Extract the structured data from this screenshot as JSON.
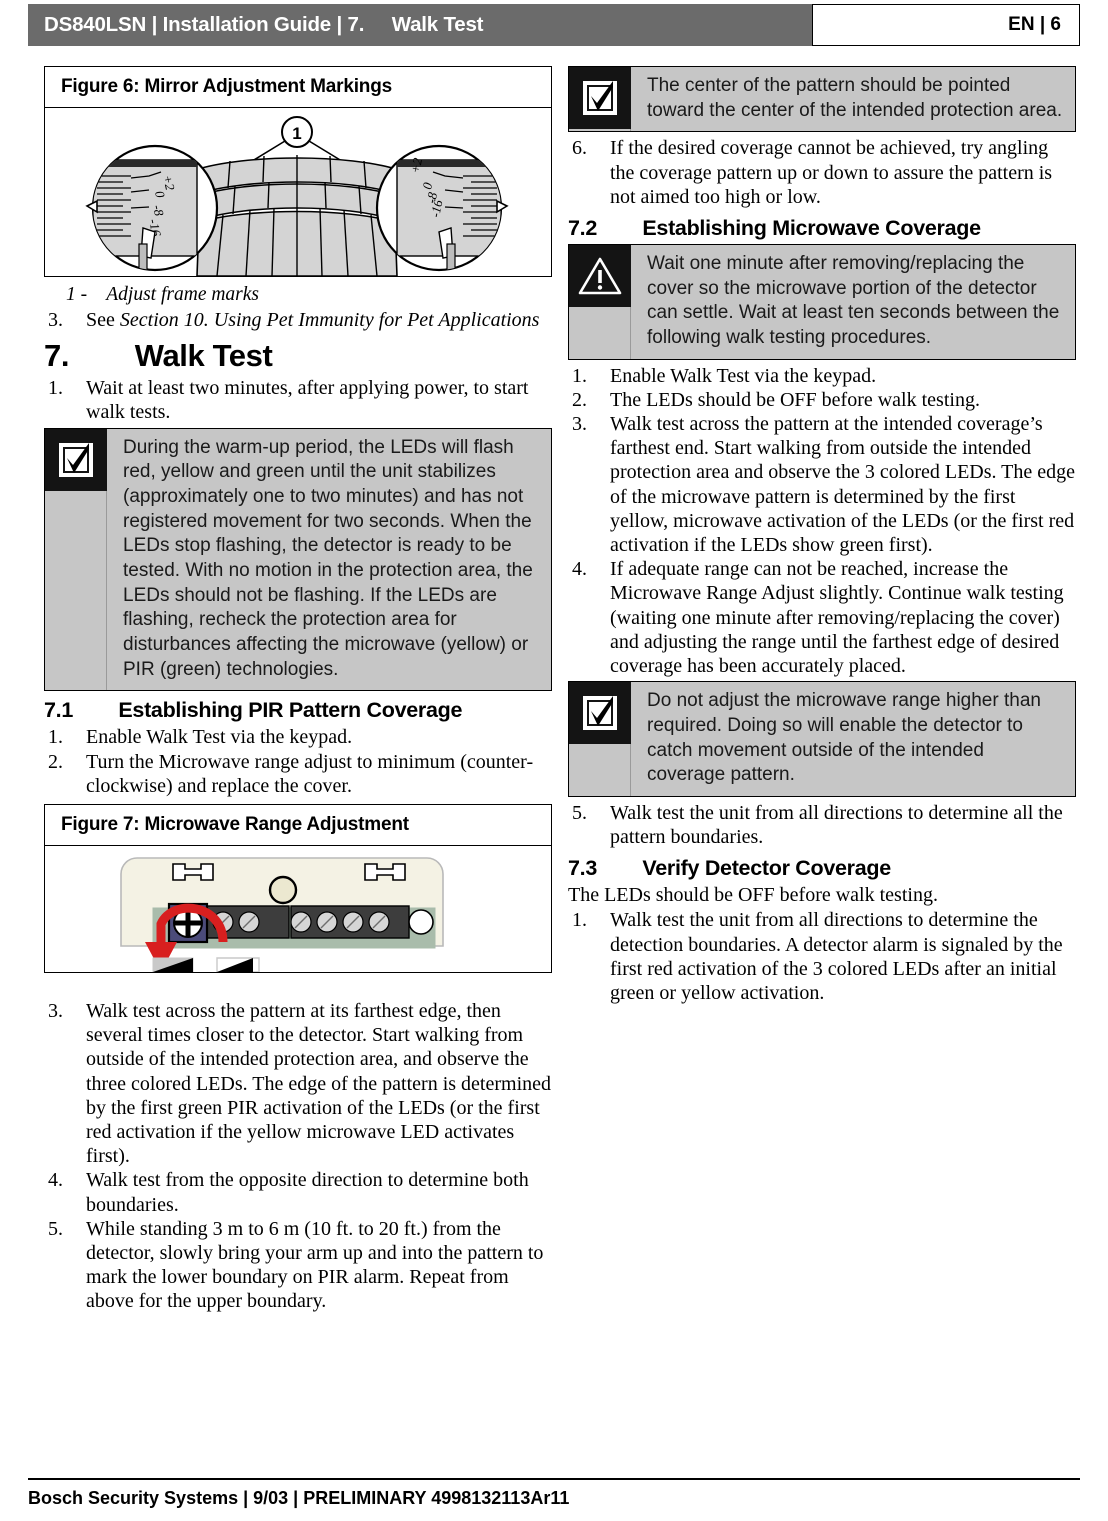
{
  "header": {
    "doc_model": "DS840LSN",
    "sep": " | ",
    "doc_type": "Installation Guide",
    "section_number": "7.",
    "section_title": "Walk Test",
    "title_full": "DS840LSN | Installation Guide | 7.     Walk Test",
    "language": "EN",
    "page": "6",
    "page_full": "EN | 6",
    "bar_color": "#6b6b6b"
  },
  "figures": {
    "fig6": {
      "caption": "Figure 6:  Mirror Adjustment Markings",
      "callout_number": "1",
      "scale_labels": [
        "+2",
        "0",
        "-8",
        "-16"
      ],
      "legend": "1 -    Adjust frame marks"
    },
    "fig7": {
      "caption": "Figure 7:  Microwave Range Adjustment"
    }
  },
  "left_column": {
    "pre_list": [
      {
        "num": "3.",
        "text_plain": "See ",
        "text_italic": "Section 10. Using Pet Immunity for Pet Applications"
      }
    ],
    "section7": {
      "number": "7.",
      "title": "Walk Test",
      "heading_full": "7.        Walk Test",
      "items": [
        {
          "num": "1.",
          "text": "Wait at least two minutes, after applying power, to start walk tests."
        }
      ]
    },
    "note_warmup": {
      "icon": "checkbox-check-icon",
      "text": "During the warm-up period, the LEDs will flash red, yellow and green until the unit stabilizes (approximately one to two minutes) and has not registered movement for two seconds. When the LEDs stop flashing, the detector is ready to be tested. With no motion in the protection area, the LEDs should not be flashing. If the LEDs are flashing, recheck the protection area for disturbances affecting the microwave (yellow) or PIR (green) technologies."
    },
    "section71": {
      "number": "7.1",
      "title": "Establishing PIR Pattern Coverage",
      "heading_full": "7.1        Establishing PIR Pattern Coverage",
      "items_before_figure": [
        {
          "num": "1.",
          "text": "Enable Walk Test via the keypad."
        },
        {
          "num": "2.",
          "text": "Turn the Microwave range adjust to minimum (counter-clockwise) and replace the cover."
        }
      ],
      "items_after_figure": [
        {
          "num": "3.",
          "text": "Walk test across the pattern at its farthest edge, then several times closer to the detector. Start walking from outside of the intended protection area, and observe the three colored LEDs. The edge of the pattern is determined by the first green PIR activation of the LEDs (or the first red activation if the yellow microwave LED activates first)."
        },
        {
          "num": "4.",
          "text": "Walk test from the opposite direction to determine both boundaries."
        },
        {
          "num": "5.",
          "text": "While standing 3 m to 6 m (10 ft. to 20 ft.) from the detector, slowly bring your arm up and into the pattern to mark the lower boundary on PIR alarm. Repeat from above for the upper boundary."
        }
      ]
    }
  },
  "right_column": {
    "note_center_pattern": {
      "icon": "checkbox-check-icon",
      "text": "The center of the pattern should be pointed toward the center of the intended protection area."
    },
    "item6": {
      "num": "6.",
      "text": "If the desired coverage cannot be achieved, try angling the coverage pattern up or down to assure the pattern is not aimed too high or low."
    },
    "section72": {
      "number": "7.2",
      "title": "Establishing Microwave Coverage",
      "heading_full": "7.2        Establishing Microwave Coverage",
      "warning": {
        "icon": "warning-triangle-icon",
        "text": "Wait one minute after removing/replacing the cover so the microwave portion of the detector can settle.  Wait at least ten seconds between the following walk testing procedures."
      },
      "items": [
        {
          "num": "1.",
          "text": "Enable Walk Test via the keypad."
        },
        {
          "num": "2.",
          "text": "The LEDs should be OFF before walk testing."
        },
        {
          "num": "3.",
          "text": "Walk test across the pattern at the intended coverage’s farthest end. Start walking from outside the intended protection area and observe the 3 colored LEDs. The edge of the microwave pattern is determined by the first yellow, microwave activation of the LEDs (or the first red activation if the LEDs show green first)."
        },
        {
          "num": "4.",
          "text": "If adequate range can not be reached, increase the Microwave Range Adjust slightly. Continue walk testing (waiting one minute after removing/replacing the cover) and adjusting the range until the farthest edge of desired coverage has been accurately placed."
        }
      ],
      "note_do_not_adjust": {
        "icon": "checkbox-check-icon",
        "text": "Do not adjust the microwave range higher than required. Doing so will enable the detector to catch movement outside of the intended coverage pattern."
      },
      "item5": {
        "num": "5.",
        "text": "Walk test the unit from all directions to determine all the pattern boundaries."
      }
    },
    "section73": {
      "number": "7.3",
      "title": "Verify Detector Coverage",
      "heading_full": "7.3        Verify Detector Coverage",
      "intro": "The LEDs should be OFF before walk testing.",
      "items": [
        {
          "num": "1.",
          "text": "Walk test the unit from all directions to determine the detection boundaries. A detector alarm is signaled by the first red activation of the 3 colored LEDs after an initial green or yellow activation."
        }
      ]
    }
  },
  "footer": {
    "company": "Bosch Security Systems",
    "date": "9/03",
    "status": "PRELIMINARY",
    "part_number": "4998132113Ar11",
    "text_full": "Bosch Security Systems | 9/03 | PRELIMINARY 4998132113Ar11"
  }
}
